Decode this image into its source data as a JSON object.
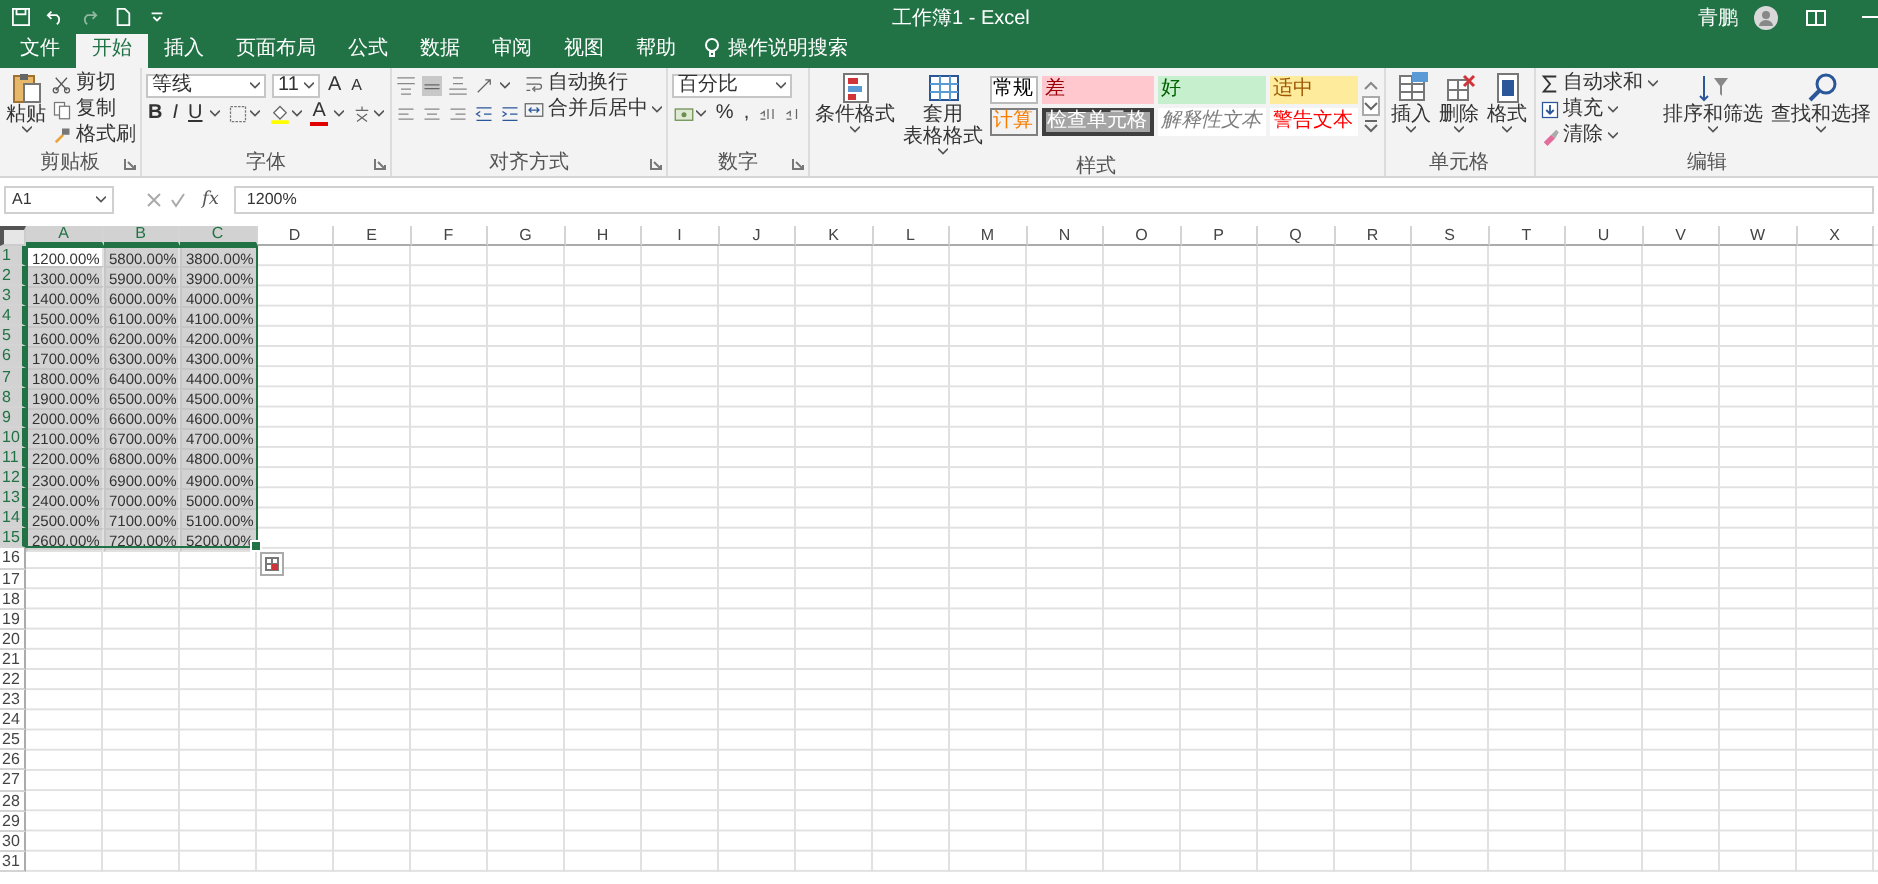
{
  "title_bar": {
    "title": "工作簿1  -  Excel",
    "user": "青鹏"
  },
  "tabs": [
    {
      "label": "文件",
      "selected": false
    },
    {
      "label": "开始",
      "selected": true
    },
    {
      "label": "插入",
      "selected": false
    },
    {
      "label": "页面布局",
      "selected": false
    },
    {
      "label": "公式",
      "selected": false
    },
    {
      "label": "数据",
      "selected": false
    },
    {
      "label": "审阅",
      "selected": false
    },
    {
      "label": "视图",
      "selected": false
    },
    {
      "label": "帮助",
      "selected": false
    }
  ],
  "tell_me": "操作说明搜索",
  "ribbon": {
    "clipboard": {
      "label": "剪贴板",
      "paste": "粘贴",
      "items": [
        "剪切",
        "复制",
        "格式刷"
      ]
    },
    "font": {
      "label": "字体",
      "name": "等线",
      "size": "11",
      "grow": "A",
      "shrink": "A",
      "bold": "B",
      "italic": "I",
      "underline": "U",
      "font_color": "A"
    },
    "alignment": {
      "label": "对齐方式",
      "wrap": "自动换行",
      "merge": "合并后居中"
    },
    "number": {
      "label": "数字",
      "format": "百分比",
      "percent": "%",
      "comma": ","
    },
    "styles": {
      "label": "样式",
      "conditional": "条件格式",
      "table": [
        "套用",
        "表格格式"
      ],
      "cells": [
        {
          "text": "常规",
          "kind": "normal"
        },
        {
          "text": "差",
          "kind": "bad"
        },
        {
          "text": "好",
          "kind": "good"
        },
        {
          "text": "适中",
          "kind": "neutral"
        },
        {
          "text": "计算",
          "kind": "calculation"
        },
        {
          "text": "检查单元格",
          "kind": "check"
        },
        {
          "text": "解释性文本",
          "kind": "explanatory"
        },
        {
          "text": "警告文本",
          "kind": "warning"
        }
      ]
    },
    "cells": {
      "label": "单元格",
      "items": [
        "插入",
        "删除",
        "格式"
      ]
    },
    "editing": {
      "label": "编辑",
      "items": [
        "自动求和",
        "填充",
        "清除"
      ],
      "sort": "排序和筛选",
      "find": "查找和选择"
    }
  },
  "formula_bar": {
    "name_box": "A1",
    "function_label": "fx",
    "formula": "1200%"
  },
  "sheet": {
    "columns": [
      {
        "label": "A",
        "selected": true
      },
      {
        "label": "B",
        "selected": true
      },
      {
        "label": "C",
        "selected": true
      },
      {
        "label": "D",
        "selected": false
      },
      {
        "label": "E",
        "selected": false
      },
      {
        "label": "F",
        "selected": false
      },
      {
        "label": "G",
        "selected": false
      },
      {
        "label": "H",
        "selected": false
      },
      {
        "label": "I",
        "selected": false
      },
      {
        "label": "J",
        "selected": false
      },
      {
        "label": "K",
        "selected": false
      },
      {
        "label": "L",
        "selected": false
      },
      {
        "label": "M",
        "selected": false
      },
      {
        "label": "N",
        "selected": false
      },
      {
        "label": "O",
        "selected": false
      },
      {
        "label": "P",
        "selected": false
      },
      {
        "label": "Q",
        "selected": false
      },
      {
        "label": "R",
        "selected": false
      },
      {
        "label": "S",
        "selected": false
      },
      {
        "label": "T",
        "selected": false
      },
      {
        "label": "U",
        "selected": false
      },
      {
        "label": "V",
        "selected": false
      },
      {
        "label": "W",
        "selected": false
      },
      {
        "label": "X",
        "selected": false
      }
    ],
    "rows": [
      {
        "number": "1",
        "selected": true,
        "cells": [
          {
            "text": "1200.00%",
            "selected": true,
            "active": true
          },
          {
            "text": "5800.00%",
            "selected": true,
            "active": false
          },
          {
            "text": "3800.00%",
            "selected": true,
            "active": false
          }
        ]
      },
      {
        "number": "2",
        "selected": true,
        "cells": [
          {
            "text": "1300.00%",
            "selected": true,
            "active": false
          },
          {
            "text": "5900.00%",
            "selected": true,
            "active": false
          },
          {
            "text": "3900.00%",
            "selected": true,
            "active": false
          }
        ]
      },
      {
        "number": "3",
        "selected": true,
        "cells": [
          {
            "text": "1400.00%",
            "selected": true,
            "active": false
          },
          {
            "text": "6000.00%",
            "selected": true,
            "active": false
          },
          {
            "text": "4000.00%",
            "selected": true,
            "active": false
          }
        ]
      },
      {
        "number": "4",
        "selected": true,
        "cells": [
          {
            "text": "1500.00%",
            "selected": true,
            "active": false
          },
          {
            "text": "6100.00%",
            "selected": true,
            "active": false
          },
          {
            "text": "4100.00%",
            "selected": true,
            "active": false
          }
        ]
      },
      {
        "number": "5",
        "selected": true,
        "cells": [
          {
            "text": "1600.00%",
            "selected": true,
            "active": false
          },
          {
            "text": "6200.00%",
            "selected": true,
            "active": false
          },
          {
            "text": "4200.00%",
            "selected": true,
            "active": false
          }
        ]
      },
      {
        "number": "6",
        "selected": true,
        "cells": [
          {
            "text": "1700.00%",
            "selected": true,
            "active": false
          },
          {
            "text": "6300.00%",
            "selected": true,
            "active": false
          },
          {
            "text": "4300.00%",
            "selected": true,
            "active": false
          }
        ]
      },
      {
        "number": "7",
        "selected": true,
        "cells": [
          {
            "text": "1800.00%",
            "selected": true,
            "active": false
          },
          {
            "text": "6400.00%",
            "selected": true,
            "active": false
          },
          {
            "text": "4400.00%",
            "selected": true,
            "active": false
          }
        ]
      },
      {
        "number": "8",
        "selected": true,
        "cells": [
          {
            "text": "1900.00%",
            "selected": true,
            "active": false
          },
          {
            "text": "6500.00%",
            "selected": true,
            "active": false
          },
          {
            "text": "4500.00%",
            "selected": true,
            "active": false
          }
        ]
      },
      {
        "number": "9",
        "selected": true,
        "cells": [
          {
            "text": "2000.00%",
            "selected": true,
            "active": false
          },
          {
            "text": "6600.00%",
            "selected": true,
            "active": false
          },
          {
            "text": "4600.00%",
            "selected": true,
            "active": false
          }
        ]
      },
      {
        "number": "10",
        "selected": true,
        "cells": [
          {
            "text": "2100.00%",
            "selected": true,
            "active": false
          },
          {
            "text": "6700.00%",
            "selected": true,
            "active": false
          },
          {
            "text": "4700.00%",
            "selected": true,
            "active": false
          }
        ]
      },
      {
        "number": "11",
        "selected": true,
        "cells": [
          {
            "text": "2200.00%",
            "selected": true,
            "active": false
          },
          {
            "text": "6800.00%",
            "selected": true,
            "active": false
          },
          {
            "text": "4800.00%",
            "selected": true,
            "active": false
          }
        ]
      },
      {
        "number": "12",
        "selected": true,
        "cells": [
          {
            "text": "2300.00%",
            "selected": true,
            "active": false
          },
          {
            "text": "6900.00%",
            "selected": true,
            "active": false
          },
          {
            "text": "4900.00%",
            "selected": true,
            "active": false
          }
        ]
      },
      {
        "number": "13",
        "selected": true,
        "cells": [
          {
            "text": "2400.00%",
            "selected": true,
            "active": false
          },
          {
            "text": "7000.00%",
            "selected": true,
            "active": false
          },
          {
            "text": "5000.00%",
            "selected": true,
            "active": false
          }
        ]
      },
      {
        "number": "14",
        "selected": true,
        "cells": [
          {
            "text": "2500.00%",
            "selected": true,
            "active": false
          },
          {
            "text": "7100.00%",
            "selected": true,
            "active": false
          },
          {
            "text": "5100.00%",
            "selected": true,
            "active": false
          }
        ]
      },
      {
        "number": "15",
        "selected": true,
        "cells": [
          {
            "text": "2600.00%",
            "selected": true,
            "active": false
          },
          {
            "text": "7200.00%",
            "selected": true,
            "active": false
          },
          {
            "text": "5200.00%",
            "selected": true,
            "active": false
          }
        ]
      },
      {
        "number": "16",
        "selected": false
      },
      {
        "number": "17",
        "selected": false
      },
      {
        "number": "18",
        "selected": false
      },
      {
        "number": "19",
        "selected": false
      },
      {
        "number": "20",
        "selected": false
      },
      {
        "number": "21",
        "selected": false
      },
      {
        "number": "22",
        "selected": false
      },
      {
        "number": "23",
        "selected": false
      },
      {
        "number": "24",
        "selected": false
      },
      {
        "number": "25",
        "selected": false
      },
      {
        "number": "26",
        "selected": false
      },
      {
        "number": "27",
        "selected": false
      },
      {
        "number": "28",
        "selected": false
      },
      {
        "number": "29",
        "selected": false
      },
      {
        "number": "30",
        "selected": false
      },
      {
        "number": "31",
        "selected": false
      }
    ]
  }
}
